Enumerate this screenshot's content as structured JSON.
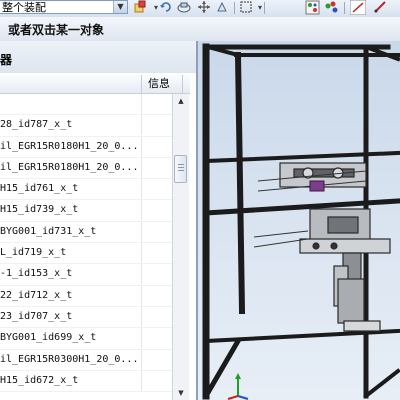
{
  "toolbar": {
    "assembly_select_value": "整个装配",
    "buttons": [
      "assembly-icon",
      "undo-icon",
      "view-icon",
      "move-icon",
      "component-icon",
      "select-box-icon",
      "snap-icon",
      "snap-points-icon",
      "line-icon",
      "pencil-icon"
    ]
  },
  "prompt": {
    "text": "或者双击某一对象"
  },
  "navigator": {
    "title": "器",
    "columns": {
      "name": "",
      "info": "信息"
    },
    "rows": [
      {
        "name": ""
      },
      {
        "name": "28_id787_x_t"
      },
      {
        "name": "il_EGR15R0180H1_20_0..."
      },
      {
        "name": "il_EGR15R0180H1_20_0..."
      },
      {
        "name": "H15_id761_x_t"
      },
      {
        "name": "H15_id739_x_t"
      },
      {
        "name": "BYG001_id731_x_t"
      },
      {
        "name": "L_id719_x_t"
      },
      {
        "name": "-1_id153_x_t"
      },
      {
        "name": "22_id712_x_t"
      },
      {
        "name": "23_id707_x_t"
      },
      {
        "name": "BYG001_id699_x_t"
      },
      {
        "name": "il_EGR15R0300H1_20_0..."
      },
      {
        "name": "H15_id672_x_t"
      }
    ]
  },
  "colors": {
    "frame": "#1b1b1b",
    "frame_highlight": "#8a8a8a",
    "viewport_top": "#c9d8ea",
    "axis_x": "#d02020",
    "axis_y": "#20a020",
    "axis_z": "#2050d0"
  }
}
